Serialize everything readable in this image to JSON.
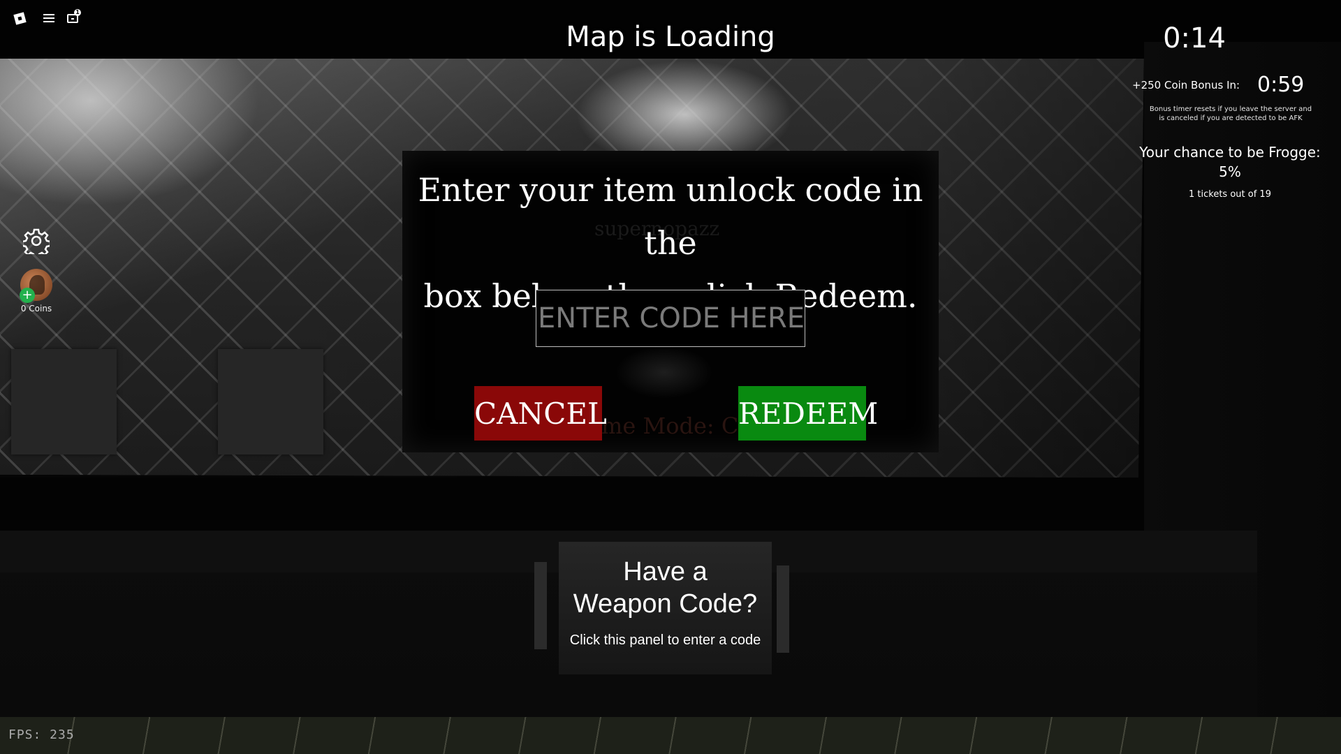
{
  "topbar": {
    "icons": [
      "roblox-logo-icon",
      "hamburger-menu-icon",
      "chat-icon"
    ],
    "chat_badge": "1"
  },
  "hud": {
    "status": "Map is Loading",
    "round_timer": "0:14",
    "bonus": {
      "label": "+250 Coin Bonus In:",
      "timer": "0:59",
      "note_line1": "Bonus timer resets if you leave the server and",
      "note_line2": "is canceled if you are detected to be AFK"
    },
    "frogge": {
      "label": "Your chance to be Frogge:",
      "percent": "5%",
      "tickets": "1 tickets out of 19"
    },
    "coins_label": "0 Coins",
    "coin_plus": "+",
    "fps": "FPS: 235"
  },
  "modal": {
    "title_line1": "Enter your item unlock code in the",
    "title_line2": "box below, then click Redeem.",
    "input_placeholder": "ENTER CODE HERE",
    "input_value": "",
    "cancel_label": "CANCEL",
    "redeem_label": "REDEEM",
    "cancel_color": "#8a0808",
    "redeem_color": "#098a10",
    "background_name": "supernopazz",
    "background_mode": "me Mode: Cla"
  },
  "weapon_panel": {
    "title_line1": "Have a",
    "title_line2": "Weapon Code?",
    "subtitle": "Click this panel to enter a code"
  }
}
